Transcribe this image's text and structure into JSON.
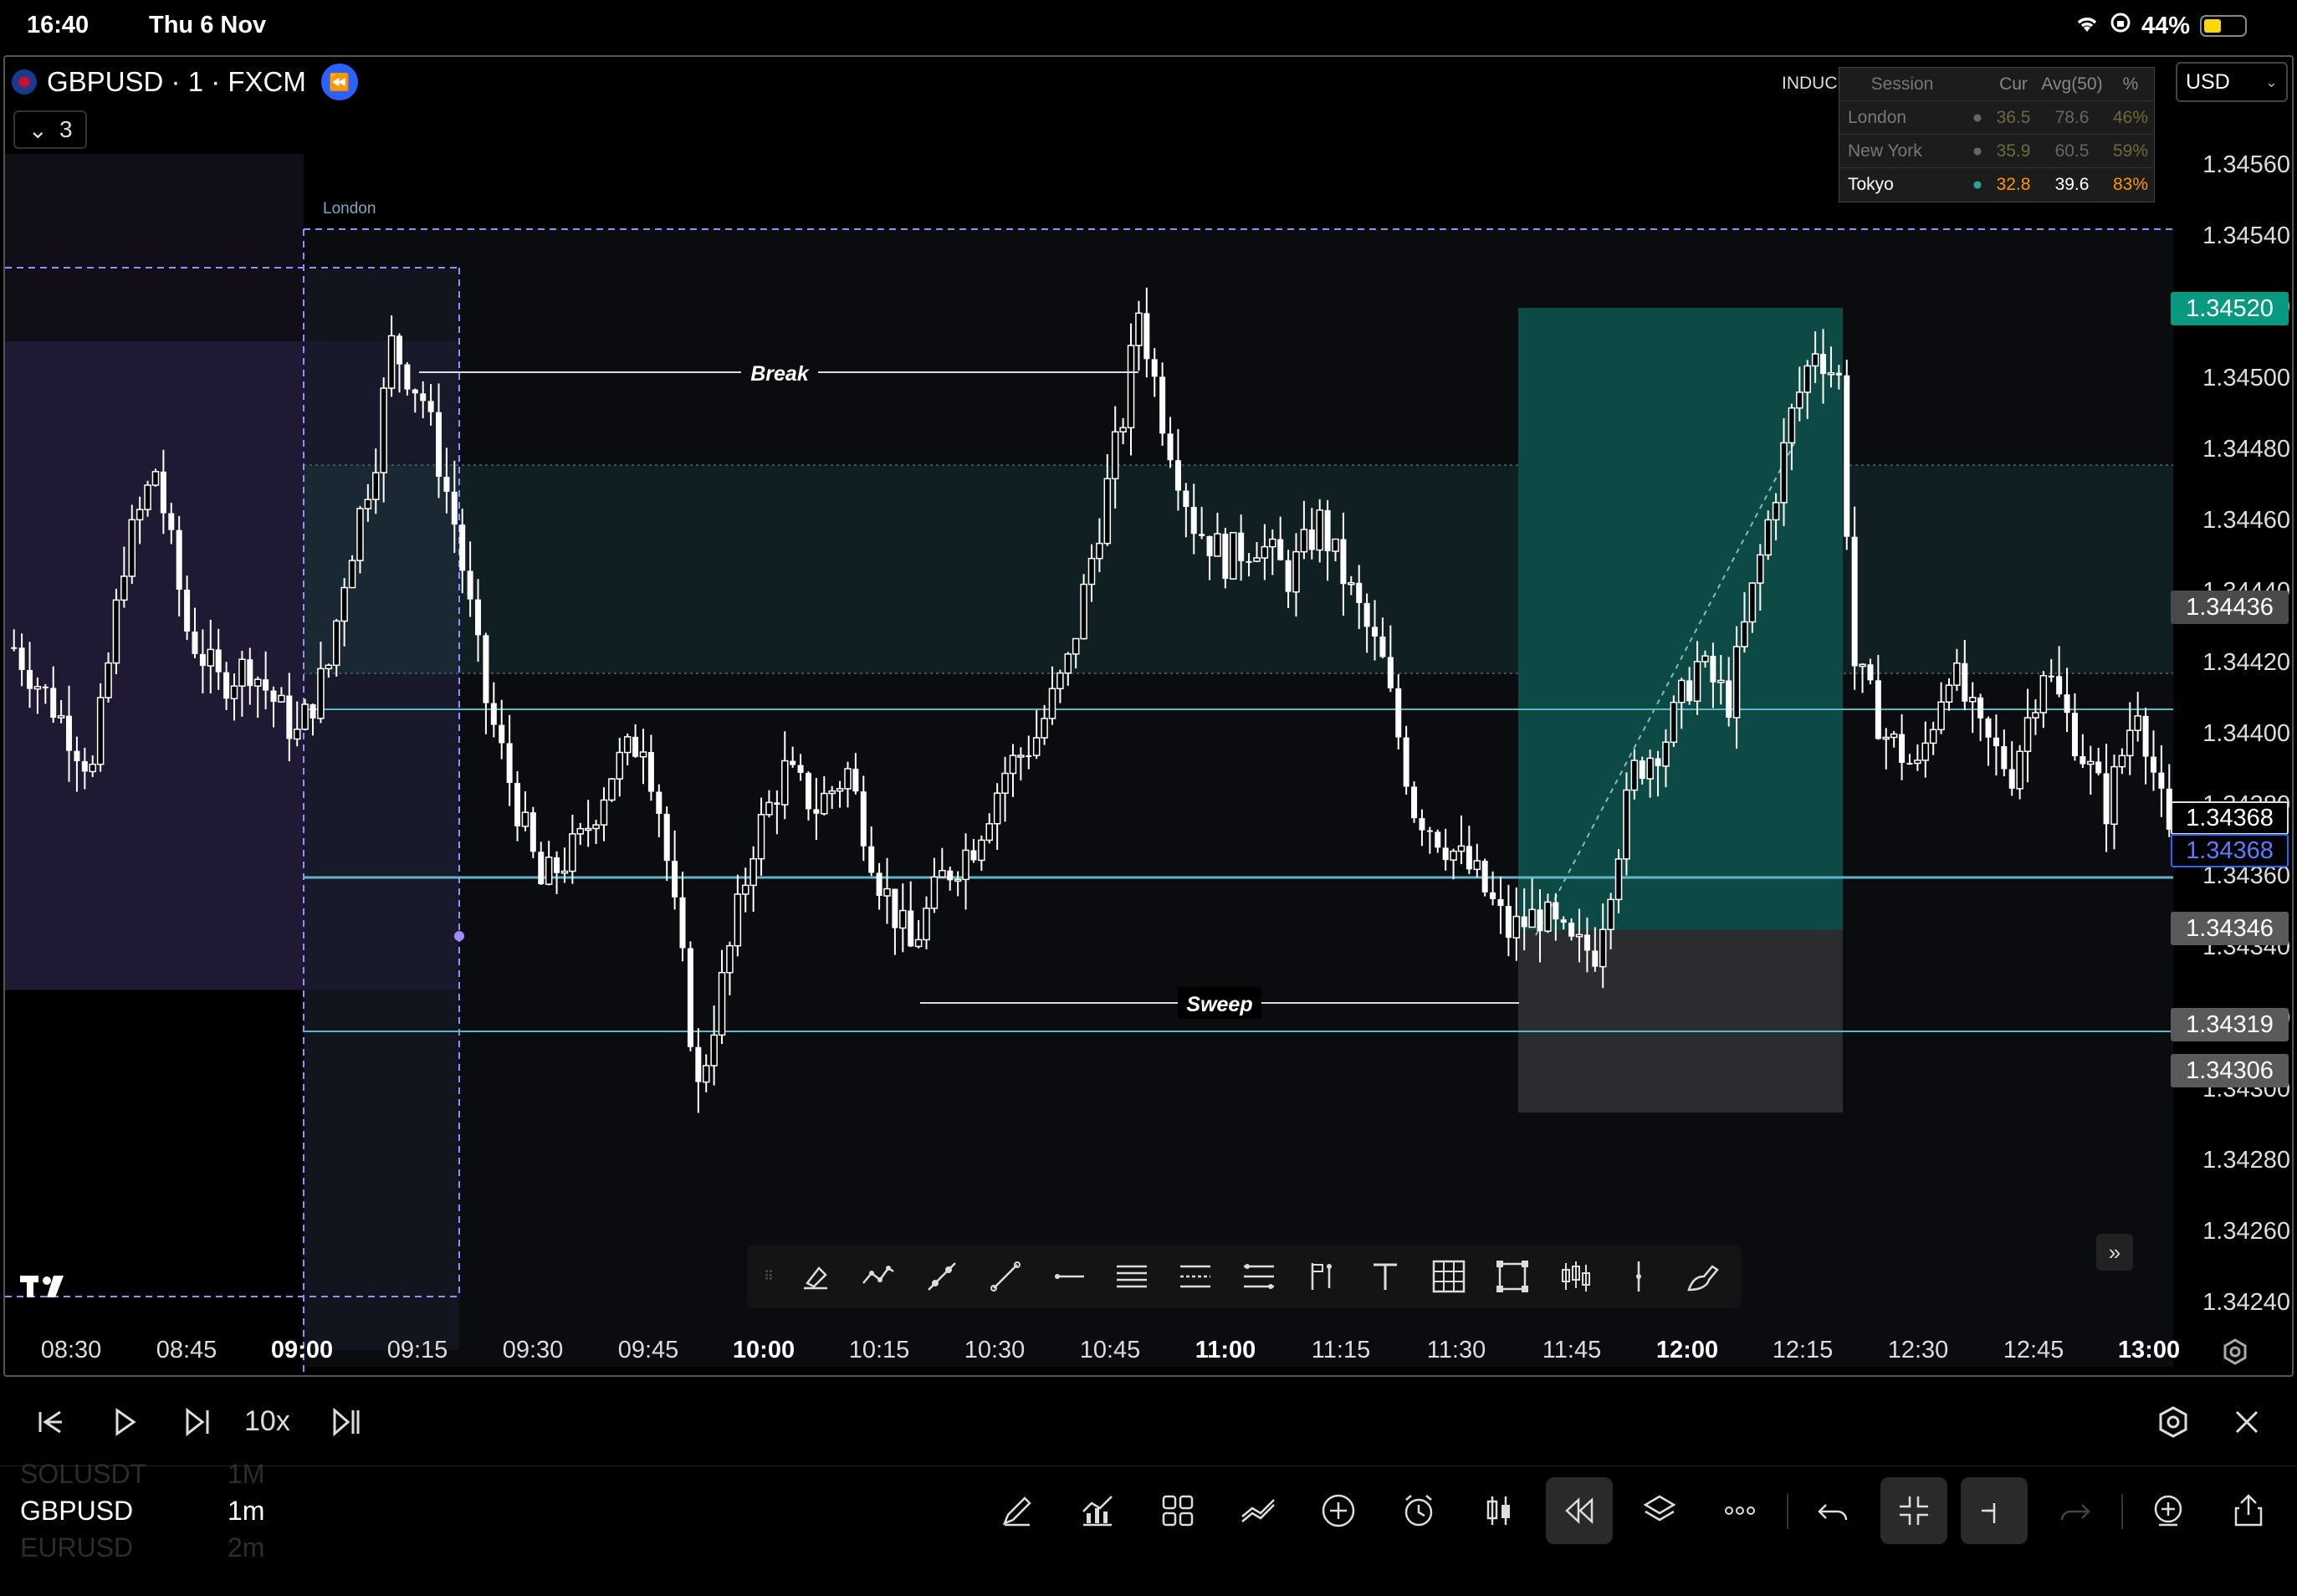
{
  "status": {
    "time": "16:40",
    "date": "Thu 6 Nov",
    "battery": "44%"
  },
  "header": {
    "symbol_title": "GBPUSD · 1 · FXCM",
    "indicator_count": "3",
    "currency": "USD",
    "indicator_label": "INDUC"
  },
  "session_table": {
    "headers": [
      "Session",
      "Cur",
      "Avg(50)",
      "%"
    ],
    "rows": [
      {
        "name": "London",
        "cur": "36.5",
        "avg": "78.6",
        "pct": "46%",
        "active": false
      },
      {
        "name": "New York",
        "cur": "35.9",
        "avg": "60.5",
        "pct": "59%",
        "active": false
      },
      {
        "name": "Tokyo",
        "cur": "32.8",
        "avg": "39.6",
        "pct": "83%",
        "active": true
      }
    ]
  },
  "chart_labels": {
    "session": "London",
    "break": "Break",
    "sweep": "Sweep"
  },
  "price_axis": [
    "1.34560",
    "1.34540",
    "1.34520",
    "1.34500",
    "1.34480",
    "1.34460",
    "1.34440",
    "1.34420",
    "1.34400",
    "1.34380",
    "1.34360",
    "1.34340",
    "1.34320",
    "1.34300",
    "1.34280",
    "1.34260",
    "1.34240"
  ],
  "price_tags": {
    "target": "1.34520",
    "upper_level": "1.34436",
    "last": "1.34368",
    "last_blue": "1.34368",
    "entry": "1.34346",
    "low_level": "1.34319",
    "stop": "1.34306"
  },
  "colors": {
    "up": "#ffffff",
    "down": "#ffffff",
    "target_zone": "#0e4a45",
    "stop_zone": "#2a2c30",
    "level": "#5fb6c8",
    "tag_target": "#089981",
    "tag_grey": "#5a5a5a",
    "accent": "#2962ff"
  },
  "time_axis": [
    "08:30",
    "08:45",
    "09:00",
    "09:15",
    "09:30",
    "09:45",
    "10:00",
    "10:15",
    "10:30",
    "10:45",
    "11:00",
    "11:15",
    "11:30",
    "11:45",
    "12:00",
    "12:15",
    "12:30",
    "12:45",
    "13:00"
  ],
  "time_axis_bold": [
    "09:00",
    "10:00",
    "11:00",
    "12:00",
    "13:00"
  ],
  "replay": {
    "speed": "10x"
  },
  "watchlist": [
    {
      "symbol": "SOLUSDT",
      "tf": "1M",
      "dim": true
    },
    {
      "symbol": "GBPUSD",
      "tf": "1m",
      "dim": false
    },
    {
      "symbol": "EURUSD",
      "tf": "2m",
      "dim": true
    }
  ],
  "chart_data": {
    "type": "candlestick",
    "symbol": "GBPUSD",
    "interval": "1m",
    "ylim": [
      1.3423,
      1.3457
    ],
    "xlim": [
      "08:24",
      "13:03"
    ],
    "levels": [
      1.34436,
      1.34368,
      1.34346,
      1.34319,
      1.34306
    ],
    "close_path": [
      [
        0,
        1.34425
      ],
      [
        6,
        1.34405
      ],
      [
        10,
        1.3439
      ],
      [
        14,
        1.3445
      ],
      [
        18,
        1.34475
      ],
      [
        22,
        1.3443
      ],
      [
        26,
        1.34415
      ],
      [
        30,
        1.3442
      ],
      [
        36,
        1.344
      ],
      [
        40,
        1.3442
      ],
      [
        42,
        1.34445
      ],
      [
        46,
        1.3448
      ],
      [
        48,
        1.3451
      ],
      [
        52,
        1.34495
      ],
      [
        56,
        1.3446
      ],
      [
        60,
        1.3441
      ],
      [
        64,
        1.3438
      ],
      [
        67,
        1.34358
      ],
      [
        72,
        1.3437
      ],
      [
        76,
        1.3439
      ],
      [
        80,
        1.344
      ],
      [
        82,
        1.3438
      ],
      [
        85,
        1.34335
      ],
      [
        87,
        1.343
      ],
      [
        90,
        1.3433
      ],
      [
        94,
        1.3437
      ],
      [
        98,
        1.3439
      ],
      [
        102,
        1.3438
      ],
      [
        106,
        1.3439
      ],
      [
        110,
        1.3436
      ],
      [
        114,
        1.3434
      ],
      [
        118,
        1.3436
      ],
      [
        122,
        1.3437
      ],
      [
        126,
        1.3439
      ],
      [
        130,
        1.344
      ],
      [
        134,
        1.3442
      ],
      [
        138,
        1.3446
      ],
      [
        141,
        1.3449
      ],
      [
        143,
        1.3452
      ],
      [
        146,
        1.3449
      ],
      [
        150,
        1.3446
      ],
      [
        154,
        1.3445
      ],
      [
        158,
        1.34455
      ],
      [
        162,
        1.34445
      ],
      [
        166,
        1.3446
      ],
      [
        170,
        1.3444
      ],
      [
        174,
        1.3442
      ],
      [
        178,
        1.3438
      ],
      [
        182,
        1.3437
      ],
      [
        186,
        1.3436
      ],
      [
        190,
        1.34345
      ],
      [
        194,
        1.3435
      ],
      [
        198,
        1.3434
      ],
      [
        201,
        1.3434
      ],
      [
        203,
        1.3436
      ],
      [
        206,
        1.3439
      ],
      [
        210,
        1.344
      ],
      [
        214,
        1.3442
      ],
      [
        218,
        1.3441
      ],
      [
        222,
        1.3445
      ],
      [
        226,
        1.3449
      ],
      [
        229,
        1.3451
      ],
      [
        232,
        1.345
      ],
      [
        234,
        1.3442
      ],
      [
        238,
        1.344
      ],
      [
        242,
        1.3439
      ],
      [
        246,
        1.3442
      ],
      [
        250,
        1.344
      ],
      [
        254,
        1.3439
      ],
      [
        258,
        1.3442
      ],
      [
        262,
        1.344
      ],
      [
        266,
        1.3438
      ],
      [
        270,
        1.3441
      ],
      [
        274,
        1.3437
      ]
    ]
  }
}
